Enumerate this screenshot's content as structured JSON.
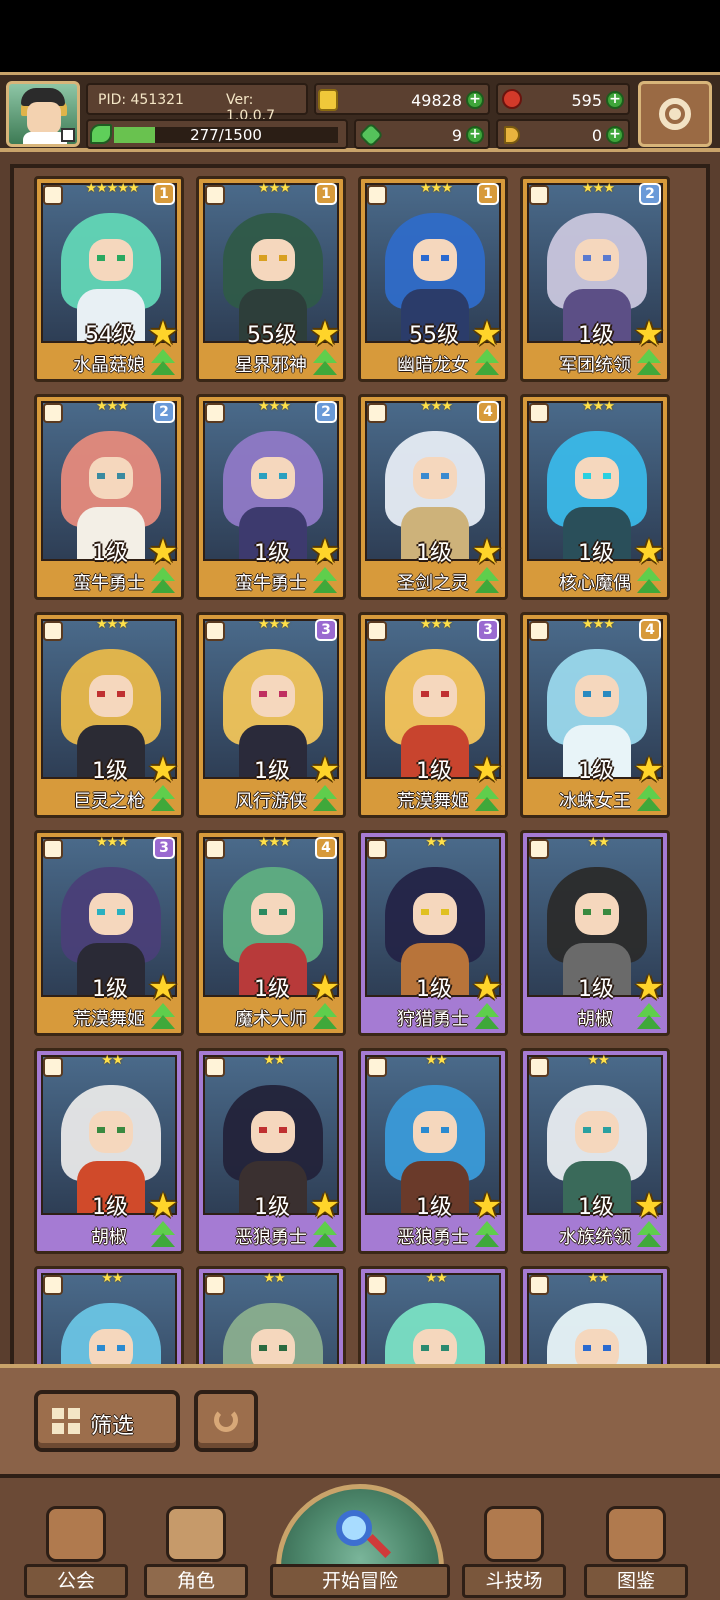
{
  "header": {
    "pid": "PID: 451321",
    "version": "Ver: 1.0.0.7",
    "gold": "49828",
    "gems": "595",
    "clover": "9",
    "horn": "0",
    "exp": "277/1500",
    "exp_fraction": 0.185
  },
  "characters": [
    {
      "name": "水晶菇娘",
      "level": "54级",
      "stars": "★★★★★",
      "grade": "1",
      "frame": "gold",
      "hair": "#62d6b6",
      "body": "#e8f0f4",
      "eye": "#2aa860"
    },
    {
      "name": "星界邪神",
      "level": "55级",
      "stars": "★★★",
      "grade": "1",
      "frame": "gold",
      "hair": "#2f5a48",
      "body": "#2d3e3a",
      "eye": "#d9a020"
    },
    {
      "name": "幽暗龙女",
      "level": "55级",
      "stars": "★★★",
      "grade": "1",
      "frame": "gold",
      "hair": "#2f6cc8",
      "body": "#2b3c6a",
      "eye": "#2a6ad0"
    },
    {
      "name": "军团统领",
      "level": "1级",
      "stars": "★★★",
      "grade": "2",
      "frame": "gold",
      "hair": "#c9c6dd",
      "body": "#5c4f86",
      "eye": "#5a7ad0"
    },
    {
      "name": "蛮牛勇士",
      "level": "1级",
      "stars": "★★★",
      "grade": "2",
      "frame": "gold",
      "hair": "#e58a7c",
      "body": "#f3efe6",
      "eye": "#3a8aa0"
    },
    {
      "name": "蛮牛勇士",
      "level": "1级",
      "stars": "★★★",
      "grade": "2",
      "frame": "gold",
      "hair": "#8f79c6",
      "body": "#3d3a6e",
      "eye": "#2aa0c0"
    },
    {
      "name": "圣剑之灵",
      "level": "1级",
      "stars": "★★★",
      "grade": "4",
      "frame": "gold",
      "hair": "#e6ecf4",
      "body": "#cdb27a",
      "eye": "#3a8ad0"
    },
    {
      "name": "核心魔偶",
      "level": "1级",
      "stars": "★★★",
      "grade": "",
      "frame": "gold",
      "hair": "#3ab8e8",
      "body": "#2a4f5a",
      "eye": "#2ad0e0"
    },
    {
      "name": "巨灵之枪",
      "level": "1级",
      "stars": "★★★",
      "grade": "",
      "frame": "gold",
      "hair": "#e8b84a",
      "body": "#2b2b34",
      "eye": "#c03030"
    },
    {
      "name": "风行游侠",
      "level": "1级",
      "stars": "★★★",
      "grade": "3",
      "frame": "gold",
      "hair": "#f0c45a",
      "body": "#2a2a3a",
      "eye": "#c03060"
    },
    {
      "name": "荒漠舞姬",
      "level": "1级",
      "stars": "★★★",
      "grade": "3",
      "frame": "gold",
      "hair": "#f4c45a",
      "body": "#c8442e",
      "eye": "#c03030"
    },
    {
      "name": "冰蛛女王",
      "level": "1级",
      "stars": "★★★",
      "grade": "4",
      "frame": "gold",
      "hair": "#9ad8ec",
      "body": "#e8f4f8",
      "eye": "#2a8ac0"
    },
    {
      "name": "荒漠舞姬",
      "level": "1级",
      "stars": "★★★",
      "grade": "3",
      "frame": "gold",
      "hair": "#4a3f78",
      "body": "#2a2a36",
      "eye": "#2ab0c0"
    },
    {
      "name": "魔术大师",
      "level": "1级",
      "stars": "★★★",
      "grade": "4",
      "frame": "gold",
      "hair": "#5fae82",
      "body": "#b83a3a",
      "eye": "#2a8a60"
    },
    {
      "name": "狩猎勇士",
      "level": "1级",
      "stars": "★★",
      "grade": "",
      "frame": "purple",
      "hair": "#242447",
      "body": "#b8743a",
      "eye": "#e0c020"
    },
    {
      "name": "胡椒",
      "level": "1级",
      "stars": "★★",
      "grade": "",
      "frame": "purple",
      "hair": "#2b2b2b",
      "body": "#6a6a6a",
      "eye": "#3a8a40"
    },
    {
      "name": "胡椒",
      "level": "1级",
      "stars": "★★",
      "grade": "",
      "frame": "purple",
      "hair": "#e8e8e8",
      "body": "#d04a2a",
      "eye": "#3a8a40"
    },
    {
      "name": "恶狼勇士",
      "level": "1级",
      "stars": "★★",
      "grade": "",
      "frame": "purple",
      "hair": "#23233a",
      "body": "#3a3030",
      "eye": "#c03030"
    },
    {
      "name": "恶狼勇士",
      "level": "1级",
      "stars": "★★",
      "grade": "",
      "frame": "purple",
      "hair": "#3a9ad8",
      "body": "#6a3a2a",
      "eye": "#2a8ad0"
    },
    {
      "name": "水族统领",
      "level": "1级",
      "stars": "★★",
      "grade": "",
      "frame": "purple",
      "hair": "#e8ecf0",
      "body": "#3a6a5a",
      "eye": "#2aa0a0"
    },
    {
      "name": "",
      "level": "",
      "stars": "★★",
      "grade": "",
      "frame": "purple",
      "hair": "#6ac4e4",
      "body": "#dfeef4",
      "eye": "#2a8ad0"
    },
    {
      "name": "",
      "level": "",
      "stars": "★★",
      "grade": "",
      "frame": "purple",
      "hair": "#8aae8e",
      "body": "#5a7a5e",
      "eye": "#2a6a40"
    },
    {
      "name": "",
      "level": "",
      "stars": "★★",
      "grade": "",
      "frame": "purple",
      "hair": "#7ae0c4",
      "body": "#cfeee4",
      "eye": "#2a8a70"
    },
    {
      "name": "",
      "level": "",
      "stars": "★★",
      "grade": "",
      "frame": "purple",
      "hair": "#e8f4f8",
      "body": "#a8c8e0",
      "eye": "#2a6ad0"
    }
  ],
  "filter": {
    "label": "筛选"
  },
  "nav": {
    "guild": "公会",
    "character": "角色",
    "adventure": "开始冒险",
    "arena": "斗技场",
    "codex": "图鉴"
  },
  "colors": {
    "gold_frame": "#d79a3b",
    "purple_frame": "#a57bd3",
    "grade_gold": "#d79a3b",
    "grade_blue": "#6a9ad8",
    "grade_purple": "#9a6ad0"
  }
}
